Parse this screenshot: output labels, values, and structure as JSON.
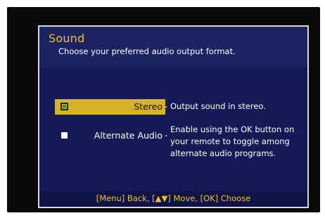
{
  "panel": {
    "title": "Sound",
    "subtitle": "Choose your preferred audio output format."
  },
  "options": [
    {
      "label": "Stereo",
      "description": "Output sound in stereo.",
      "selected": true
    },
    {
      "label": "Alternate Audio",
      "description": "Enable using the OK button on your remote to toggle among alternate audio programs.",
      "selected": false
    }
  ],
  "separator": "-",
  "footer": {
    "hint": "[Menu] Back, [▲▼] Move, [OK] Choose"
  },
  "colors": {
    "accent": "#f0c020",
    "selection": "#d8b127",
    "panel_bg": "#151a55"
  }
}
